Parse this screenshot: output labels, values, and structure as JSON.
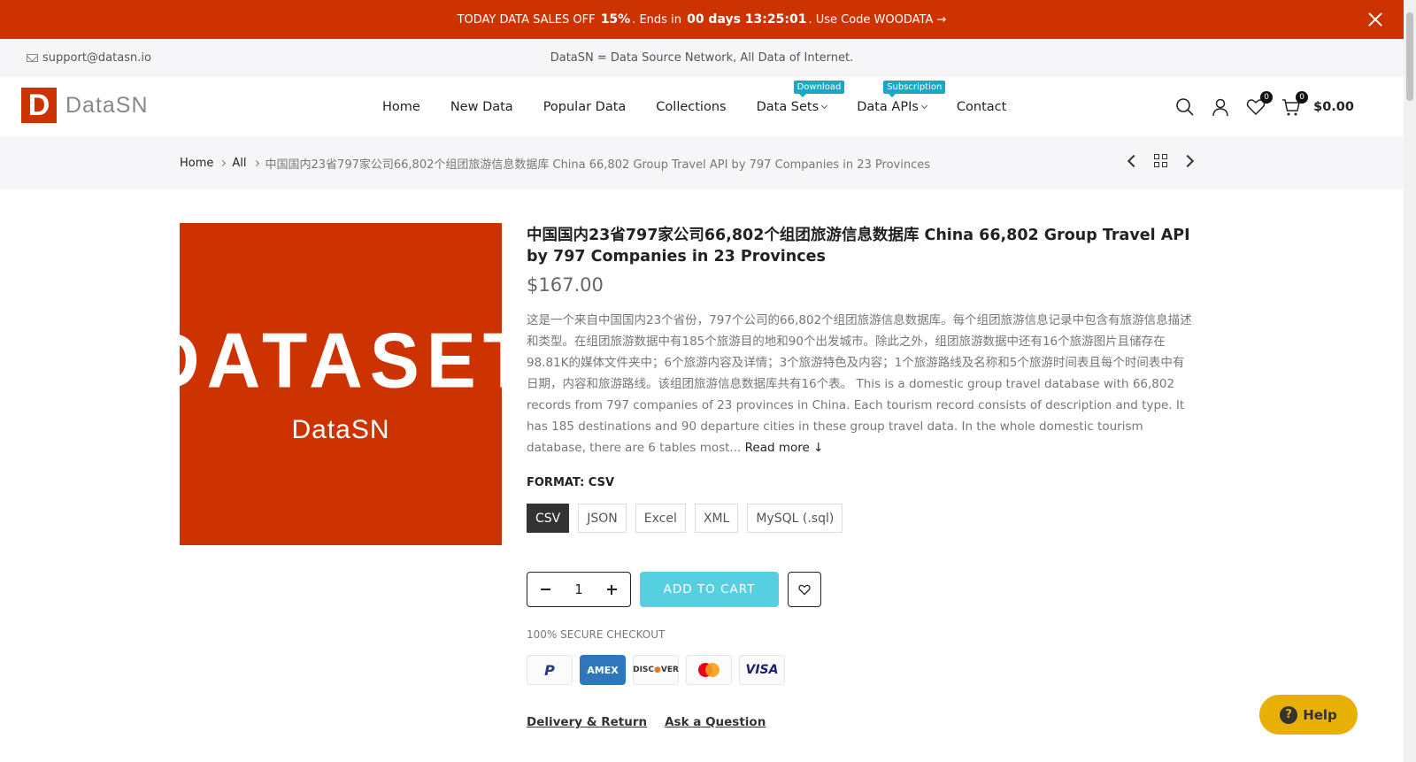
{
  "promo": {
    "text_before": "TODAY DATA SALES OFF",
    "discount": "15%",
    "text_mid": ". Ends in",
    "countdown": "00 days 13:25:01",
    "code_text": ". Use Code WOODATA →"
  },
  "topbar": {
    "email": "support@datasn.io",
    "tagline": "DataSN = Data Source Network, All Data of Internet."
  },
  "logo": {
    "mark": "D",
    "name": "DataSN"
  },
  "nav": {
    "items": [
      {
        "label": "Home"
      },
      {
        "label": "New Data"
      },
      {
        "label": "Popular Data"
      },
      {
        "label": "Collections"
      },
      {
        "label": "Data Sets",
        "badge": "Download"
      },
      {
        "label": "Data APIs",
        "badge": "Subscription"
      },
      {
        "label": "Contact"
      }
    ]
  },
  "header": {
    "wishlist_count": "0",
    "cart_count": "0",
    "cart_total": "$0.00"
  },
  "breadcrumb": {
    "home": "Home",
    "all": "All",
    "current": "中国国内23省797家公司66,802个组团旅游信息数据库 China 66,802 Group Travel API by 797 Companies in 23 Provinces"
  },
  "product": {
    "image_big": "DATASET",
    "image_small": "DataSN",
    "title": "中国国内23省797家公司66,802个组团旅游信息数据库 China 66,802 Group Travel API by 797 Companies in 23 Provinces",
    "price": "$167.00",
    "description": "这是一个来自中国国内23个省份，797个公司的66,802个组团旅游信息数据库。每个组团旅游信息记录中包含有旅游信息描述和类型。在组团旅游数据中有185个旅游目的地和90个出发城市。除此之外，组团旅游数据中还有16个旅游图片且储存在98.81K的媒体文件夹中；6个旅游内容及详情；3个旅游特色及内容；1个旅游路线及名称和5个旅游时间表且每个时间表中有日期，内容和旅游路线。该组团旅游信息数据库共有16个表。 This is a domestic group travel database with 66,802 records from 797 companies of 23 provinces in China. Each tourism record consists of description and type. It has 185 destinations and 90 departure cities in these group travel data. In the whole domestic tourism database, there are 6 tables most...",
    "read_more": "Read more ↓",
    "format_label": "FORMAT: CSV",
    "formats": [
      "CSV",
      "JSON",
      "Excel",
      "XML",
      "MySQL (.sql)"
    ],
    "quantity": "1",
    "add_to_cart": "ADD TO CART",
    "secure": "100% SECURE CHECKOUT",
    "payments": [
      "PayPal",
      "AMEX",
      "DISCOVER",
      "Mastercard",
      "VISA"
    ],
    "links": [
      "Delivery & Return",
      "Ask a Question"
    ]
  },
  "help": {
    "label": "Help"
  },
  "colors": {
    "brand": "#cc3300",
    "accent": "#56cfe1",
    "badge": "#17a9c6",
    "help": "#e8b004"
  }
}
